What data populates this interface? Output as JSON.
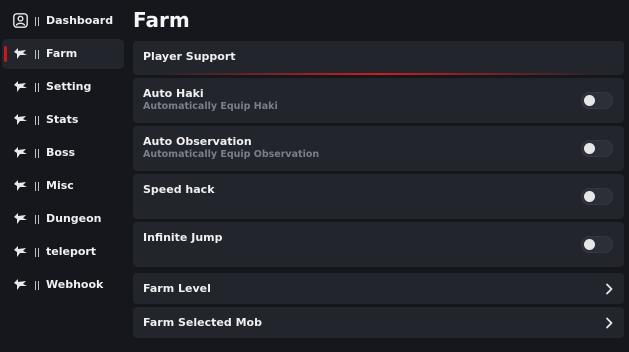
{
  "sidebar": {
    "items": [
      {
        "label": "Dashboard",
        "icon": "user-profile-icon"
      },
      {
        "label": "Farm",
        "icon": "shark-icon"
      },
      {
        "label": "Setting",
        "icon": "shark-icon"
      },
      {
        "label": "Stats",
        "icon": "shark-icon"
      },
      {
        "label": "Boss",
        "icon": "shark-icon"
      },
      {
        "label": "Misc",
        "icon": "shark-icon"
      },
      {
        "label": "Dungeon",
        "icon": "shark-icon"
      },
      {
        "label": "teleport",
        "icon": "shark-icon"
      },
      {
        "label": "Webhook",
        "icon": "shark-icon"
      }
    ],
    "active": "Farm"
  },
  "main": {
    "title": "Farm",
    "section": "Player Support",
    "toggles": [
      {
        "title": "Auto Haki",
        "desc": "Automatically Equip Haki",
        "on": false
      },
      {
        "title": "Auto Observation",
        "desc": "Automatically Equip Observation",
        "on": false
      },
      {
        "title": "Speed hack",
        "desc": "",
        "on": false
      },
      {
        "title": "Infinite Jump",
        "desc": "",
        "on": false
      }
    ],
    "dropdowns": [
      {
        "title": "Farm Level"
      },
      {
        "title": "Farm Selected Mob"
      }
    ]
  },
  "colors": {
    "background": "#15171c",
    "panel": "#22252c",
    "accent": "#c21b1b",
    "muted_text": "#7c7f87"
  }
}
